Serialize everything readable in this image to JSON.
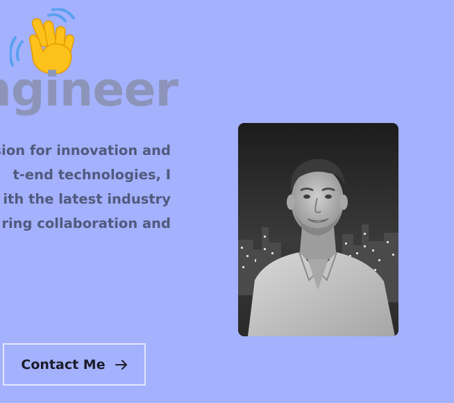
{
  "hero": {
    "emoji_icon": "waving-hand-icon",
    "headline_fragment": "ngineer",
    "intro_lines": [
      "ssion for innovation and",
      "t-end technologies, I",
      "ith the latest industry",
      "ring collaboration and"
    ]
  },
  "cta": {
    "label": "Contact Me",
    "icon": "arrow-right-icon"
  },
  "colors": {
    "background": "#a4b1fd",
    "headline": "#8c95b9",
    "body_text": "#505a7d",
    "button_border": "#e3e7ff",
    "button_text": "#1b1c2a"
  }
}
